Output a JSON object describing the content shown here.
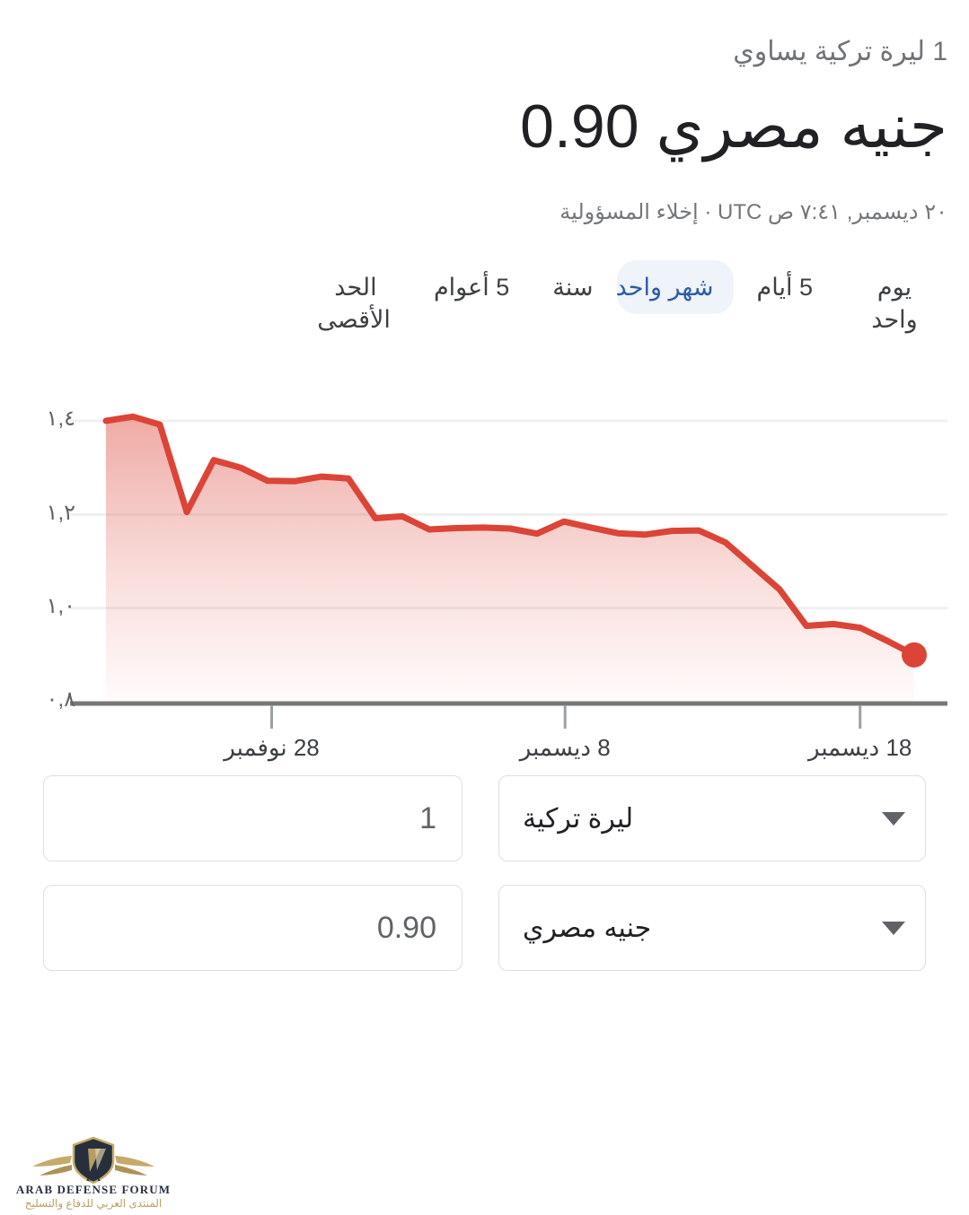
{
  "header": {
    "subtitle": "1 ليرة تركية يساوي",
    "value": "0.90",
    "target_currency": "جنيه مصري",
    "timestamp": "٢٠ ديسمبر, ٧:٤١ ص UTC",
    "separator": "·",
    "disclaimer": "إخلاء المسؤولية"
  },
  "ranges": {
    "tabs": [
      {
        "label": "يوم واحد",
        "active": false
      },
      {
        "label": "5 أيام",
        "active": false
      },
      {
        "label": "شهر واحد",
        "active": true
      },
      {
        "label": "سنة",
        "active": false
      },
      {
        "label": "5 أعوام",
        "active": false
      },
      {
        "label": "الحد الأقصى",
        "active": false
      }
    ],
    "active_index": 2,
    "active_color": "#2c5ca6",
    "active_bg": "#eff3fa"
  },
  "chart_data": {
    "type": "area",
    "title": "",
    "xlabel": "",
    "ylabel": "",
    "grid": true,
    "legend": null,
    "line_color": "#db4437",
    "fill_top_color": "rgba(219,68,55,0.42)",
    "fill_bottom_color": "rgba(219,68,55,0.02)",
    "ylim": [
      0.8,
      1.45
    ],
    "ytick_labels": [
      "١,٤",
      "١,٢",
      "١,٠",
      "٠,٨"
    ],
    "ytick_values": [
      1.4,
      1.2,
      1.0,
      0.8
    ],
    "xtick_labels": [
      "28 نوفمبر",
      "8 ديسمبر",
      "18 ديسمبر"
    ],
    "xtick_positions": [
      0.205,
      0.568,
      0.933
    ],
    "last_point_value": 0.9,
    "x": [
      0,
      1,
      2,
      3,
      4,
      5,
      6,
      7,
      8,
      9,
      10,
      11,
      12,
      13,
      14,
      15,
      16,
      17,
      18,
      19,
      20,
      21,
      22,
      23,
      24,
      25,
      26,
      27,
      28,
      29,
      30
    ],
    "values": [
      1.4,
      1.409,
      1.392,
      1.205,
      1.316,
      1.3,
      1.272,
      1.271,
      1.281,
      1.277,
      1.192,
      1.196,
      1.168,
      1.171,
      1.172,
      1.17,
      1.159,
      1.185,
      1.172,
      1.16,
      1.157,
      1.165,
      1.166,
      1.14,
      1.09,
      1.04,
      0.962,
      0.966,
      0.958,
      0.93,
      0.9
    ]
  },
  "converter": {
    "rows": [
      {
        "currency": "ليرة تركية",
        "amount": "1"
      },
      {
        "currency": "جنيه مصري",
        "amount": "0.90"
      }
    ]
  },
  "watermark": {
    "line1": "ARAB DEFENSE FORUM",
    "line2": "المنتدى العربي للدفاع والتسليح",
    "gold": "#c2a662",
    "navy": "#1c2433"
  }
}
